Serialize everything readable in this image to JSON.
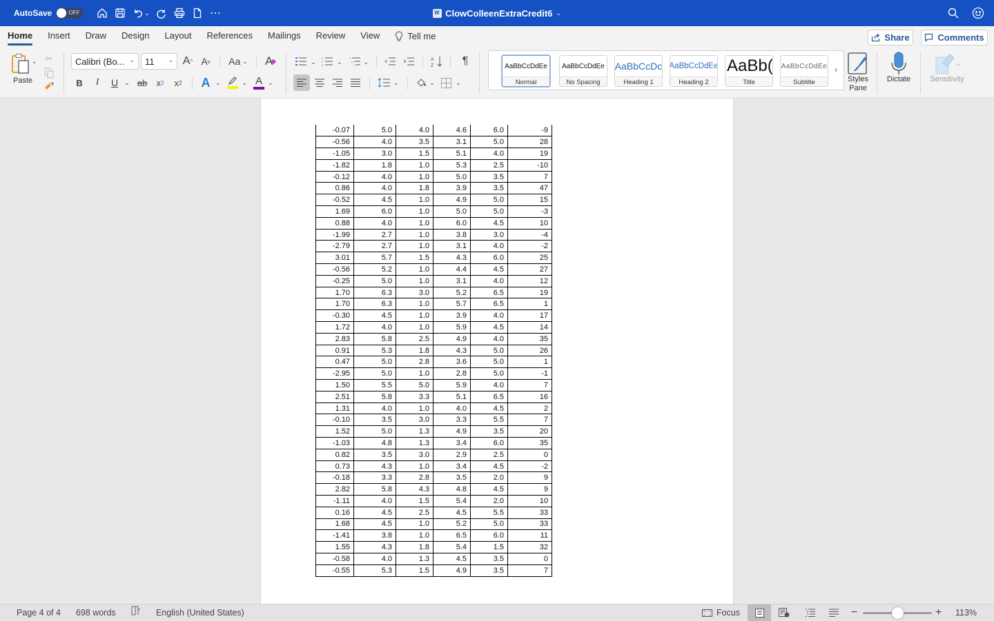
{
  "titlebar": {
    "autosave_label": "AutoSave",
    "autosave_state": "OFF",
    "document_title": "ClowColleenExtraCredit6",
    "icons": [
      "home-icon",
      "save-icon",
      "undo-icon",
      "redo-icon",
      "print-icon",
      "new-document-icon",
      "more-icon",
      "search-icon",
      "feedback-smiley-icon"
    ]
  },
  "ribbon_tabs": [
    {
      "label": "Home",
      "active": true
    },
    {
      "label": "Insert"
    },
    {
      "label": "Draw"
    },
    {
      "label": "Design"
    },
    {
      "label": "Layout"
    },
    {
      "label": "References"
    },
    {
      "label": "Mailings"
    },
    {
      "label": "Review"
    },
    {
      "label": "View"
    }
  ],
  "tell_me": "Tell me",
  "share_label": "Share",
  "comments_label": "Comments",
  "ribbon": {
    "paste_label": "Paste",
    "font_name": "Calibri (Bo...",
    "font_size": "11",
    "highlight_color": "#f5f500",
    "font_color": "#7a0f9c",
    "styles": [
      {
        "sample": "AaBbCcDdEe",
        "name": "Normal",
        "selected": true
      },
      {
        "sample": "AaBbCcDdEe",
        "name": "No Spacing"
      },
      {
        "sample": "AaBbCcDc",
        "name": "Heading 1"
      },
      {
        "sample": "AaBbCcDdEe",
        "name": "Heading 2"
      },
      {
        "sample": "AaBb(",
        "name": "Title"
      },
      {
        "sample": "AaBbCcDdEe",
        "name": "Subtitle"
      }
    ],
    "styles_pane_label": "Styles Pane",
    "dictate_label": "Dictate",
    "sensitivity_label": "Sensitivity"
  },
  "table": {
    "rows": [
      [
        "-0.07",
        "5.0",
        "4.0",
        "4.6",
        "6.0",
        "-9"
      ],
      [
        "-0.56",
        "4.0",
        "3.5",
        "3.1",
        "5.0",
        "28"
      ],
      [
        "-1.05",
        "3.0",
        "1.5",
        "5.1",
        "4.0",
        "19"
      ],
      [
        "-1.82",
        "1.8",
        "1.0",
        "5.3",
        "2.5",
        "-10"
      ],
      [
        "-0.12",
        "4.0",
        "1.0",
        "5.0",
        "3.5",
        "7"
      ],
      [
        "0.86",
        "4.0",
        "1.8",
        "3.9",
        "3.5",
        "47"
      ],
      [
        "-0.52",
        "4.5",
        "1.0",
        "4.9",
        "5.0",
        "15"
      ],
      [
        "1.69",
        "6.0",
        "1.0",
        "5.0",
        "5.0",
        "-3"
      ],
      [
        "0.88",
        "4.0",
        "1.0",
        "6.0",
        "4.5",
        "10"
      ],
      [
        "-1.99",
        "2.7",
        "1.0",
        "3.8",
        "3.0",
        "-4"
      ],
      [
        "-2.79",
        "2.7",
        "1.0",
        "3.1",
        "4.0",
        "-2"
      ],
      [
        "3.01",
        "5.7",
        "1.5",
        "4.3",
        "6.0",
        "25"
      ],
      [
        "-0.56",
        "5.2",
        "1.0",
        "4.4",
        "4.5",
        "27"
      ],
      [
        "-0.25",
        "5.0",
        "1.0",
        "3.1",
        "4.0",
        "12"
      ],
      [
        "1.70",
        "6.3",
        "3.0",
        "5.2",
        "6.5",
        "19"
      ],
      [
        "1.70",
        "6.3",
        "1.0",
        "5.7",
        "6.5",
        "1"
      ],
      [
        "-0.30",
        "4.5",
        "1.0",
        "3.9",
        "4.0",
        "17"
      ],
      [
        "1.72",
        "4.0",
        "1.0",
        "5.9",
        "4.5",
        "14"
      ],
      [
        "2.83",
        "5.8",
        "2.5",
        "4.9",
        "4.0",
        "35"
      ],
      [
        "0.91",
        "5.3",
        "1.8",
        "4.3",
        "5.0",
        "26"
      ],
      [
        "0.47",
        "5.0",
        "2.8",
        "3.6",
        "5.0",
        "1"
      ],
      [
        "-2.95",
        "5.0",
        "1.0",
        "2.8",
        "5.0",
        "-1"
      ],
      [
        "1.50",
        "5.5",
        "5.0",
        "5.9",
        "4.0",
        "7"
      ],
      [
        "2.51",
        "5.8",
        "3.3",
        "5.1",
        "6.5",
        "16"
      ],
      [
        "1.31",
        "4.0",
        "1.0",
        "4.0",
        "4.5",
        "2"
      ],
      [
        "-0.10",
        "3.5",
        "3.0",
        "3.3",
        "5.5",
        "7"
      ],
      [
        "1.52",
        "5.0",
        "1.3",
        "4.9",
        "3.5",
        "20"
      ],
      [
        "-1.03",
        "4.8",
        "1.3",
        "3.4",
        "6.0",
        "35"
      ],
      [
        "0.82",
        "3.5",
        "3.0",
        "2.9",
        "2.5",
        "0"
      ],
      [
        "0.73",
        "4.3",
        "1.0",
        "3.4",
        "4.5",
        "-2"
      ],
      [
        "-0.18",
        "3.3",
        "2.8",
        "3.5",
        "2.0",
        "9"
      ],
      [
        "2.82",
        "5.8",
        "4.3",
        "4.8",
        "4.5",
        "9"
      ],
      [
        "-1.11",
        "4.0",
        "1.5",
        "5.4",
        "2.0",
        "10"
      ],
      [
        "0.16",
        "4.5",
        "2.5",
        "4.5",
        "5.5",
        "33"
      ],
      [
        "1.68",
        "4.5",
        "1.0",
        "5.2",
        "5.0",
        "33"
      ],
      [
        "-1.41",
        "3.8",
        "1.0",
        "6.5",
        "6.0",
        "11"
      ],
      [
        "1.55",
        "4.3",
        "1.8",
        "5.4",
        "1.5",
        "32"
      ],
      [
        "-0.58",
        "4.0",
        "1.3",
        "4.5",
        "3.5",
        "0"
      ],
      [
        "-0.55",
        "5.3",
        "1.5",
        "4.9",
        "3.5",
        "7"
      ]
    ]
  },
  "statusbar": {
    "page": "Page 4 of 4",
    "words": "698 words",
    "language": "English (United States)",
    "focus_label": "Focus",
    "zoom_percent": "113%",
    "zoom_value": 113
  }
}
